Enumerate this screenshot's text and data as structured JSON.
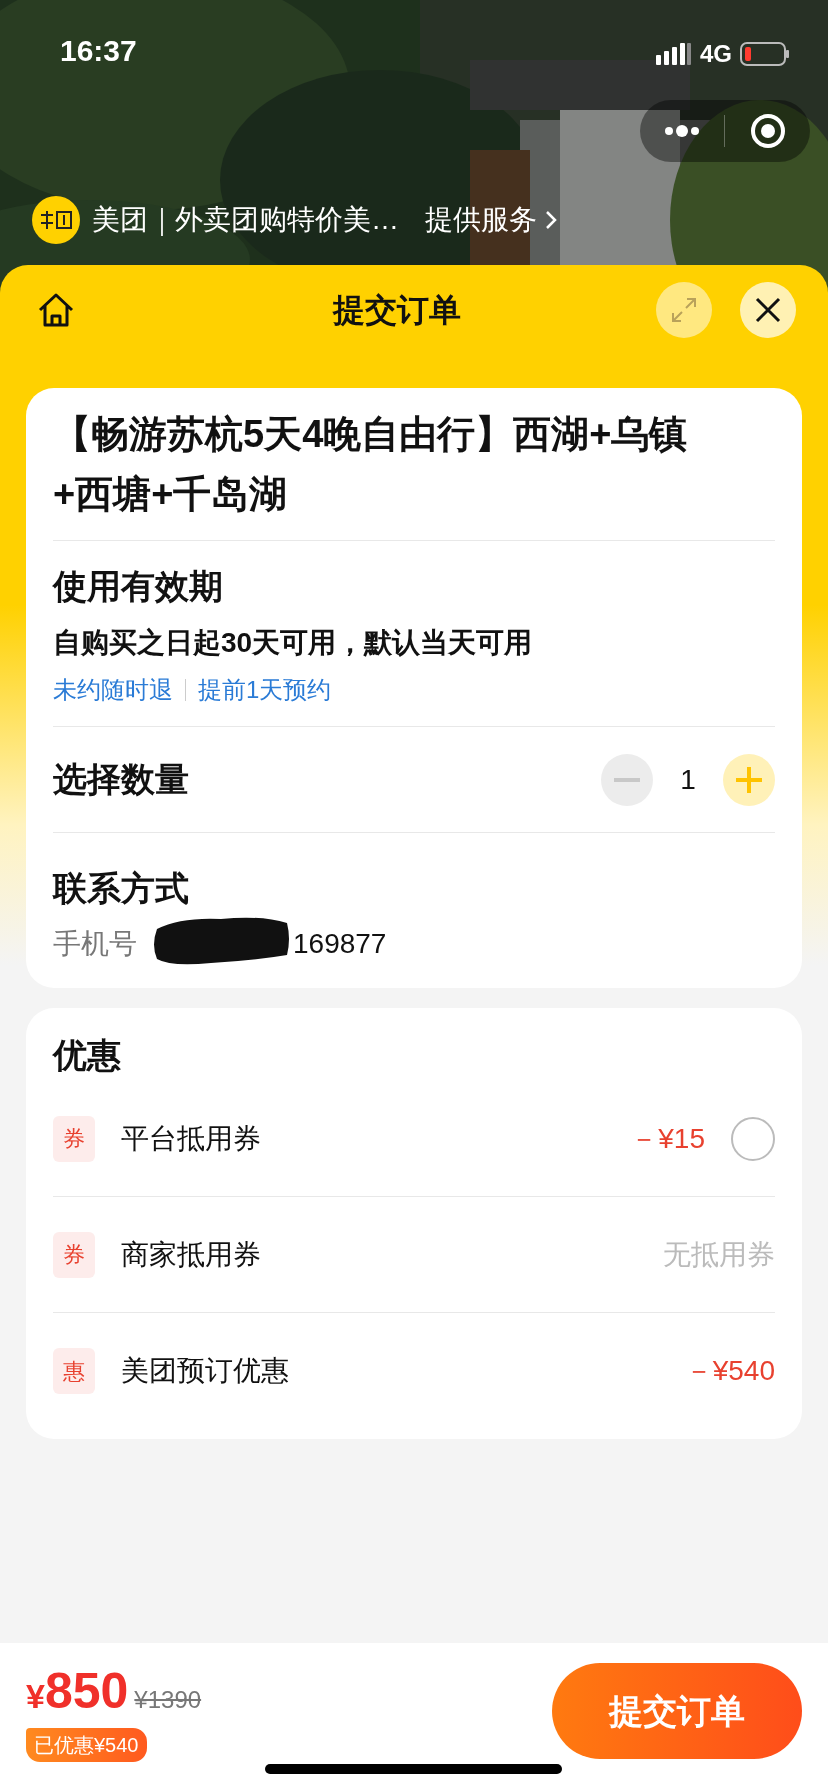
{
  "status_bar": {
    "time": "16:37",
    "network": "4G"
  },
  "mini_program": {
    "name": "美团｜外卖团购特价美…",
    "service_link": "提供服务"
  },
  "header": {
    "title": "提交订单"
  },
  "product": {
    "title": "【畅游苏杭5天4晚自由行】西湖+乌镇+西塘+千岛湖"
  },
  "validity": {
    "heading": "使用有效期",
    "description": "自购买之日起30天可用，默认当天可用",
    "tags": [
      "未约随时退",
      "提前1天预约"
    ]
  },
  "quantity": {
    "label": "选择数量",
    "value": "1",
    "minus_disabled": true
  },
  "contact": {
    "heading": "联系方式",
    "phone_label": "手机号",
    "phone_visible": "169877"
  },
  "discounts": {
    "heading": "优惠",
    "items": [
      {
        "badge": "券",
        "label": "平台抵用券",
        "value": "－¥15",
        "kind": "selectable",
        "selected": false
      },
      {
        "badge": "券",
        "label": "商家抵用券",
        "value": "无抵用券",
        "kind": "unavailable"
      },
      {
        "badge": "惠",
        "label": "美团预订优惠",
        "value": "－¥540",
        "kind": "applied"
      }
    ]
  },
  "footer": {
    "price_symbol": "¥",
    "price": "850",
    "original_price": "¥1390",
    "saved": "已优惠¥540",
    "submit": "提交订单"
  }
}
